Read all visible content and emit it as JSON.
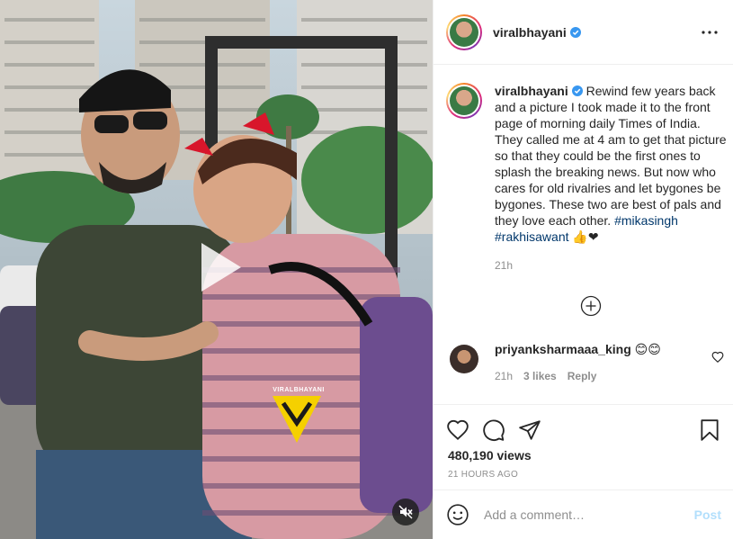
{
  "post": {
    "author": "viralbhayani",
    "caption_text": " Rewind few years back and a picture I took made it to the front page of morning daily Times of India. They called me at 4 am to get that picture so that they could be the first ones to splash the breaking news. But now who cares for old rivalries and let bygones be bygones. These two are best of pals and they love each other. ",
    "hashtags": [
      "#mikasingh",
      "#rakhisawant"
    ],
    "caption_emoji": "👍❤",
    "caption_time": "21h",
    "views": "480,190 views",
    "posted_ago": "21 HOURS AGO"
  },
  "media": {
    "watermark": "VIRALBHAYANI"
  },
  "comments": [
    {
      "username": "priyanksharmaaa_king",
      "text": "😊😊",
      "time": "21h",
      "likes": "3 likes",
      "reply": "Reply"
    }
  ],
  "add_comment": {
    "placeholder": "Add a comment…",
    "post_label": "Post"
  },
  "icons": [
    "more-options-icon",
    "verified-badge-icon",
    "play-icon",
    "mute-icon",
    "load-more-comments-icon",
    "heart-icon",
    "comment-icon",
    "share-icon",
    "bookmark-icon",
    "emoji-icon"
  ],
  "colors": {
    "verified": "#3897f0",
    "hashtag": "#00376b",
    "post_disabled": "#b2dffc",
    "muted_text": "#8e8e8e"
  }
}
